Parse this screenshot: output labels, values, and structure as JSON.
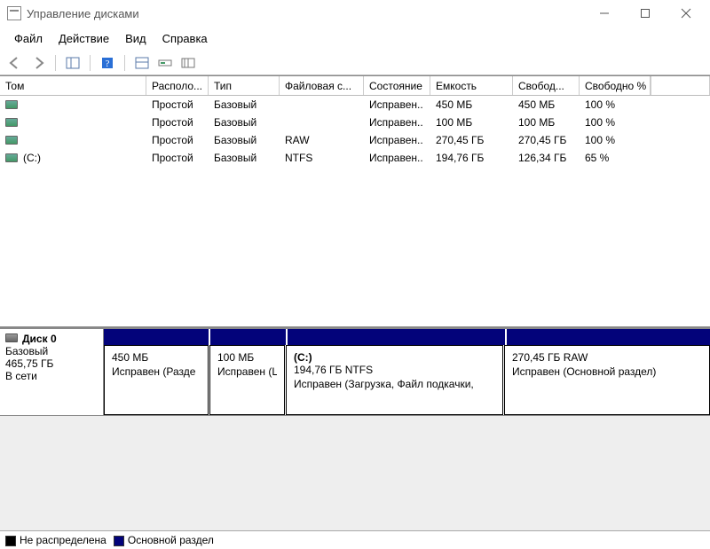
{
  "window": {
    "title": "Управление дисками"
  },
  "menu": {
    "file": "Файл",
    "action": "Действие",
    "view": "Вид",
    "help": "Справка"
  },
  "columns": {
    "c0": "Том",
    "c1": "Располо...",
    "c2": "Тип",
    "c3": "Файловая с...",
    "c4": "Состояние",
    "c5": "Емкость",
    "c6": "Свобод...",
    "c7": "Свободно %"
  },
  "rows": [
    {
      "name": "",
      "layout": "Простой",
      "type": "Базовый",
      "fs": "",
      "status": "Исправен..",
      "cap": "450 МБ",
      "free": "450 МБ",
      "pct": "100 %"
    },
    {
      "name": "",
      "layout": "Простой",
      "type": "Базовый",
      "fs": "",
      "status": "Исправен..",
      "cap": "100 МБ",
      "free": "100 МБ",
      "pct": "100 %"
    },
    {
      "name": "",
      "layout": "Простой",
      "type": "Базовый",
      "fs": "RAW",
      "status": "Исправен..",
      "cap": "270,45 ГБ",
      "free": "270,45 ГБ",
      "pct": "100 %"
    },
    {
      "name": "(C:)",
      "layout": "Простой",
      "type": "Базовый",
      "fs": "NTFS",
      "status": "Исправен..",
      "cap": "194,76 ГБ",
      "free": "126,34 ГБ",
      "pct": "65 %"
    }
  ],
  "disk": {
    "name": "Диск 0",
    "type": "Базовый",
    "size": "465,75 ГБ",
    "status": "В сети"
  },
  "parts": [
    {
      "title": "",
      "cap": "450 МБ",
      "detail": "Исправен (Разде"
    },
    {
      "title": "",
      "cap": "100 МБ",
      "detail": "Исправен (Ц"
    },
    {
      "title": "(C:)",
      "cap": "194,76 ГБ NTFS",
      "detail": "Исправен (Загрузка, Файл подкачки,"
    },
    {
      "title": "",
      "cap": "270,45 ГБ RAW",
      "detail": "Исправен (Основной раздел)"
    }
  ],
  "legend": {
    "unalloc": "Не распределена",
    "primary": "Основной раздел"
  }
}
